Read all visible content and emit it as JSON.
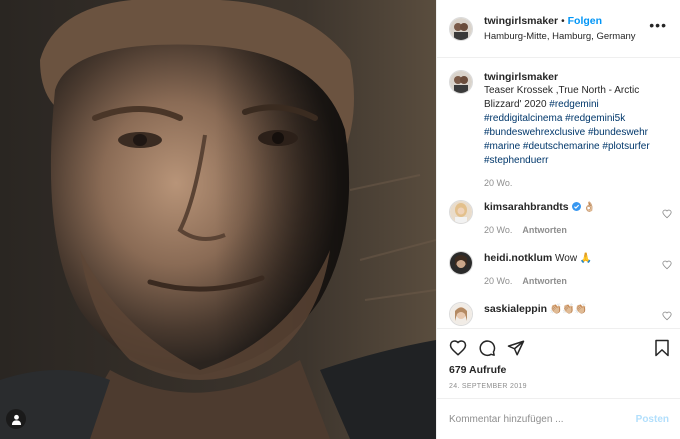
{
  "header": {
    "username": "twingirlsmaker",
    "separator": "•",
    "follow_label": "Folgen",
    "location": "Hamburg-Mitte, Hamburg, Germany",
    "more_label": "•••"
  },
  "caption": {
    "username": "twingirlsmaker",
    "text": "Teaser Krossek ,True North - Arctic Blizzard' 2020",
    "hashtags_line1": "#redgemini",
    "hashtags_line2": "#reddigitalcinema #redgemini5k",
    "hashtags_line3": "#bundeswehrexclusive #bundeswehr",
    "hashtags_line4": "#marine #deutschemarine #plotsurfer",
    "hashtags_line5": "#stephenduerr",
    "time": "20 Wo."
  },
  "comments": [
    {
      "username": "kimsarahbrandts",
      "text": "👌🏼",
      "time": "20 Wo.",
      "reply_label": "Antworten",
      "verified": true
    },
    {
      "username": "heidi.notklum",
      "text": "Wow 🙏",
      "time": "20 Wo.",
      "reply_label": "Antworten",
      "verified": false
    },
    {
      "username": "saskialeppin",
      "text": "👏🏼👏🏼👏🏼",
      "time": "",
      "reply_label": "",
      "verified": false
    }
  ],
  "stats": {
    "views": "679 Aufrufe",
    "date": "24. SEPTEMBER 2019"
  },
  "comment_input": {
    "placeholder": "Kommentar hinzufügen ...",
    "post_label": "Posten"
  },
  "colors": {
    "link": "#0095f6",
    "hashtag": "#00376b",
    "muted": "#8e8e8e",
    "post_disabled": "#b2dffc"
  },
  "icons": [
    "heart-icon",
    "comment-icon",
    "share-icon",
    "bookmark-icon",
    "user-tag-icon",
    "verified-badge-icon"
  ]
}
